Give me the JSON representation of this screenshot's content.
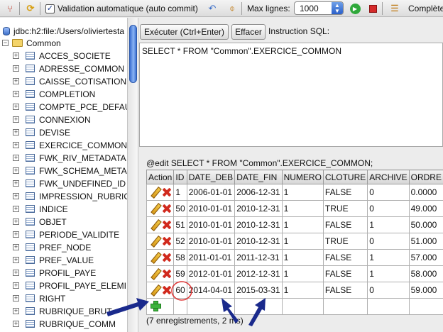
{
  "toolbar": {
    "autocommit_checkbox": "✓",
    "autocommit_label": "Validation automatique (auto commit)",
    "max_rows_label": "Max lignes:",
    "max_rows_value": "1000",
    "complete_label": "Complète"
  },
  "tree": {
    "connection": "jdbc:h2:file:/Users/oliviertesta",
    "schema": "Common",
    "tables": [
      "ACCES_SOCIETE",
      "ADRESSE_COMMON",
      "CAISSE_COTISATION",
      "COMPLETION",
      "COMPTE_PCE_DEFAU",
      "CONNEXION",
      "DEVISE",
      "EXERCICE_COMMON",
      "FWK_RIV_METADATA",
      "FWK_SCHEMA_META",
      "FWK_UNDEFINED_ID",
      "IMPRESSION_RUBRIC",
      "INDICE",
      "OBJET",
      "PERIODE_VALIDITE",
      "PREF_NODE",
      "PREF_VALUE",
      "PROFIL_PAYE",
      "PROFIL_PAYE_ELEMI",
      "RIGHT",
      "RUBRIQUE_BRUT",
      "RUBRIQUE_COMM"
    ]
  },
  "editor": {
    "execute_label": "Exécuter (Ctrl+Enter)",
    "clear_label": "Effacer",
    "sql_label": "Instruction SQL:",
    "sql_text": "SELECT * FROM \"Common\".EXERCICE_COMMON"
  },
  "result": {
    "info": "@edit SELECT * FROM \"Common\".EXERCICE_COMMON;",
    "columns": [
      "Action",
      "ID",
      "DATE_DEB",
      "DATE_FIN",
      "NUMERO",
      "CLOTURE",
      "ARCHIVE",
      "ORDRE"
    ],
    "rows": [
      [
        "1",
        "2006-01-01",
        "2006-12-31",
        "1",
        "FALSE",
        "0",
        "0.0000"
      ],
      [
        "50",
        "2010-01-01",
        "2010-12-31",
        "1",
        "TRUE",
        "0",
        "49.000"
      ],
      [
        "51",
        "2010-01-01",
        "2010-12-31",
        "1",
        "FALSE",
        "1",
        "50.000"
      ],
      [
        "52",
        "2010-01-01",
        "2010-12-31",
        "1",
        "TRUE",
        "0",
        "51.000"
      ],
      [
        "58",
        "2011-01-01",
        "2011-12-31",
        "1",
        "FALSE",
        "1",
        "57.000"
      ],
      [
        "59",
        "2012-01-01",
        "2012-12-31",
        "1",
        "FALSE",
        "1",
        "58.000"
      ],
      [
        "60",
        "2014-04-01",
        "2015-03-31",
        "1",
        "FALSE",
        "0",
        "59.000"
      ]
    ],
    "status": "(7 enregistrements, 2 ms)"
  },
  "annotation": {
    "arrow_color": "#1a2a8c",
    "circle_color": "#e03a3a"
  }
}
